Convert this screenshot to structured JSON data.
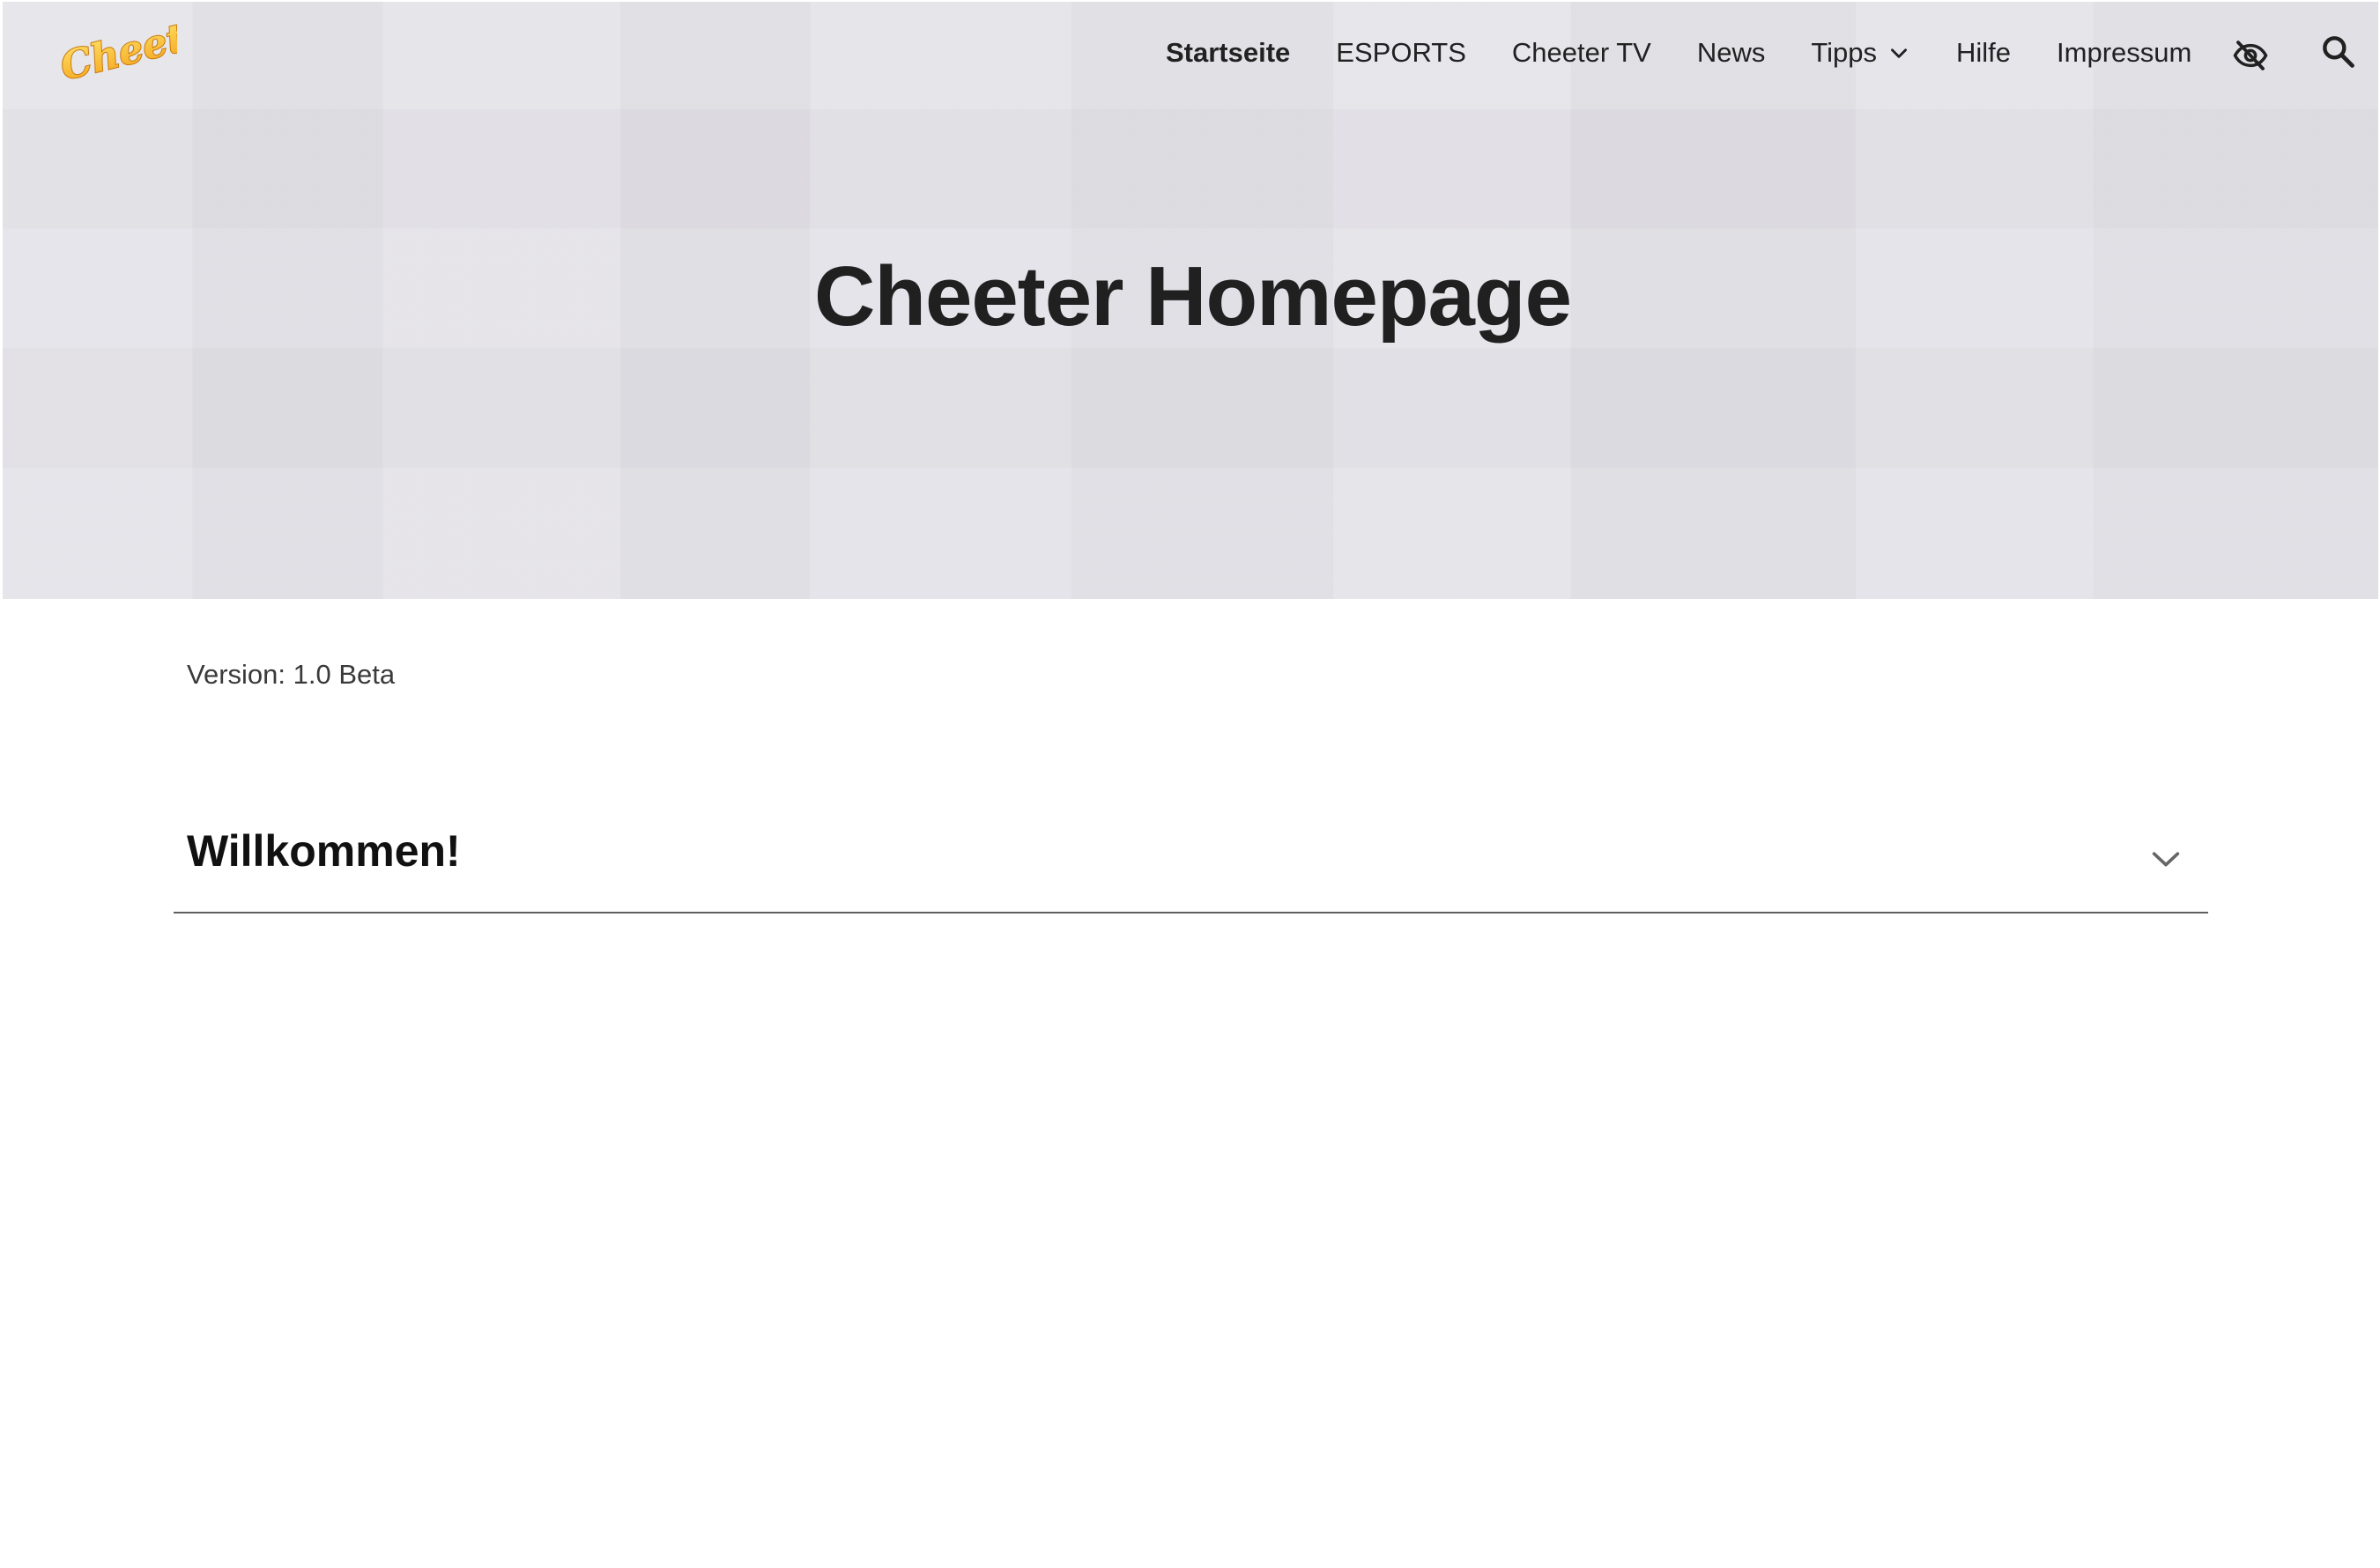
{
  "header": {
    "logo_text": "Cheeter",
    "nav": [
      {
        "label": "Startseite",
        "active": true
      },
      {
        "label": "ESPORTS",
        "active": false
      },
      {
        "label": "Cheeter TV",
        "active": false
      },
      {
        "label": "News",
        "active": false
      },
      {
        "label": "Tipps",
        "active": false,
        "has_dropdown": true
      },
      {
        "label": "Hilfe",
        "active": false
      },
      {
        "label": "Impressum",
        "active": false
      }
    ],
    "icons": [
      "eye-off-icon",
      "search-icon"
    ]
  },
  "hero": {
    "title": "Cheeter Homepage"
  },
  "main": {
    "version": "Version: 1.0 Beta",
    "accordion": {
      "title": "Willkommen!",
      "expanded": false
    }
  },
  "colors": {
    "hero_background": "#e3e2e8",
    "logo_orange": "#f7a81b",
    "logo_yellow": "#ffd43b",
    "text_dark": "#212121"
  }
}
